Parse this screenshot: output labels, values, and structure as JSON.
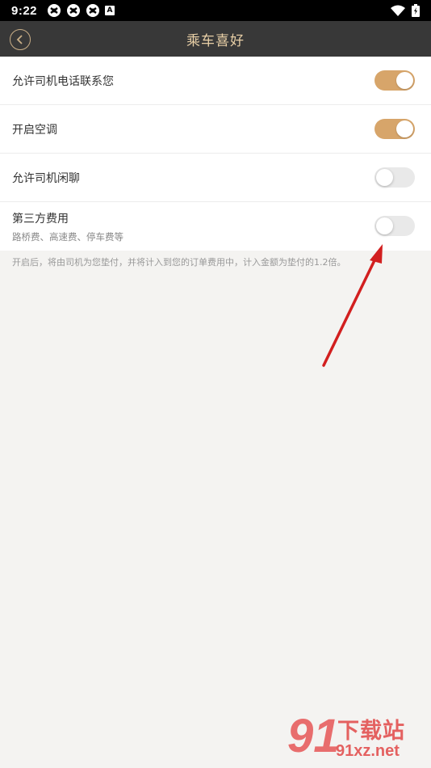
{
  "status_bar": {
    "time": "9:22",
    "left_icons": [
      "notification-icon",
      "notification-icon",
      "notification-icon",
      "a-badge-icon"
    ],
    "a_badge": "A",
    "right_icons": [
      "wifi-icon",
      "battery-icon"
    ]
  },
  "nav": {
    "title": "乘车喜好",
    "back_icon": "chevron-left-icon"
  },
  "settings": [
    {
      "label": "允许司机电话联系您",
      "on": true
    },
    {
      "label": "开启空调",
      "on": true
    },
    {
      "label": "允许司机闲聊",
      "on": false
    },
    {
      "label": "第三方费用",
      "sublabel": "路桥费、高速费、停车费等",
      "on": false
    }
  ],
  "note": "开启后，将由司机为您垫付，并将计入到您的订单费用中，计入金额为垫付的1.2倍。",
  "watermark": {
    "logo": "91",
    "title": "下载站",
    "site": "91xz.net"
  },
  "colors": {
    "nav_bg": "#383838",
    "accent": "#d7a56a",
    "title": "#e8cfa6",
    "annotation_arrow": "#d21f1f"
  }
}
